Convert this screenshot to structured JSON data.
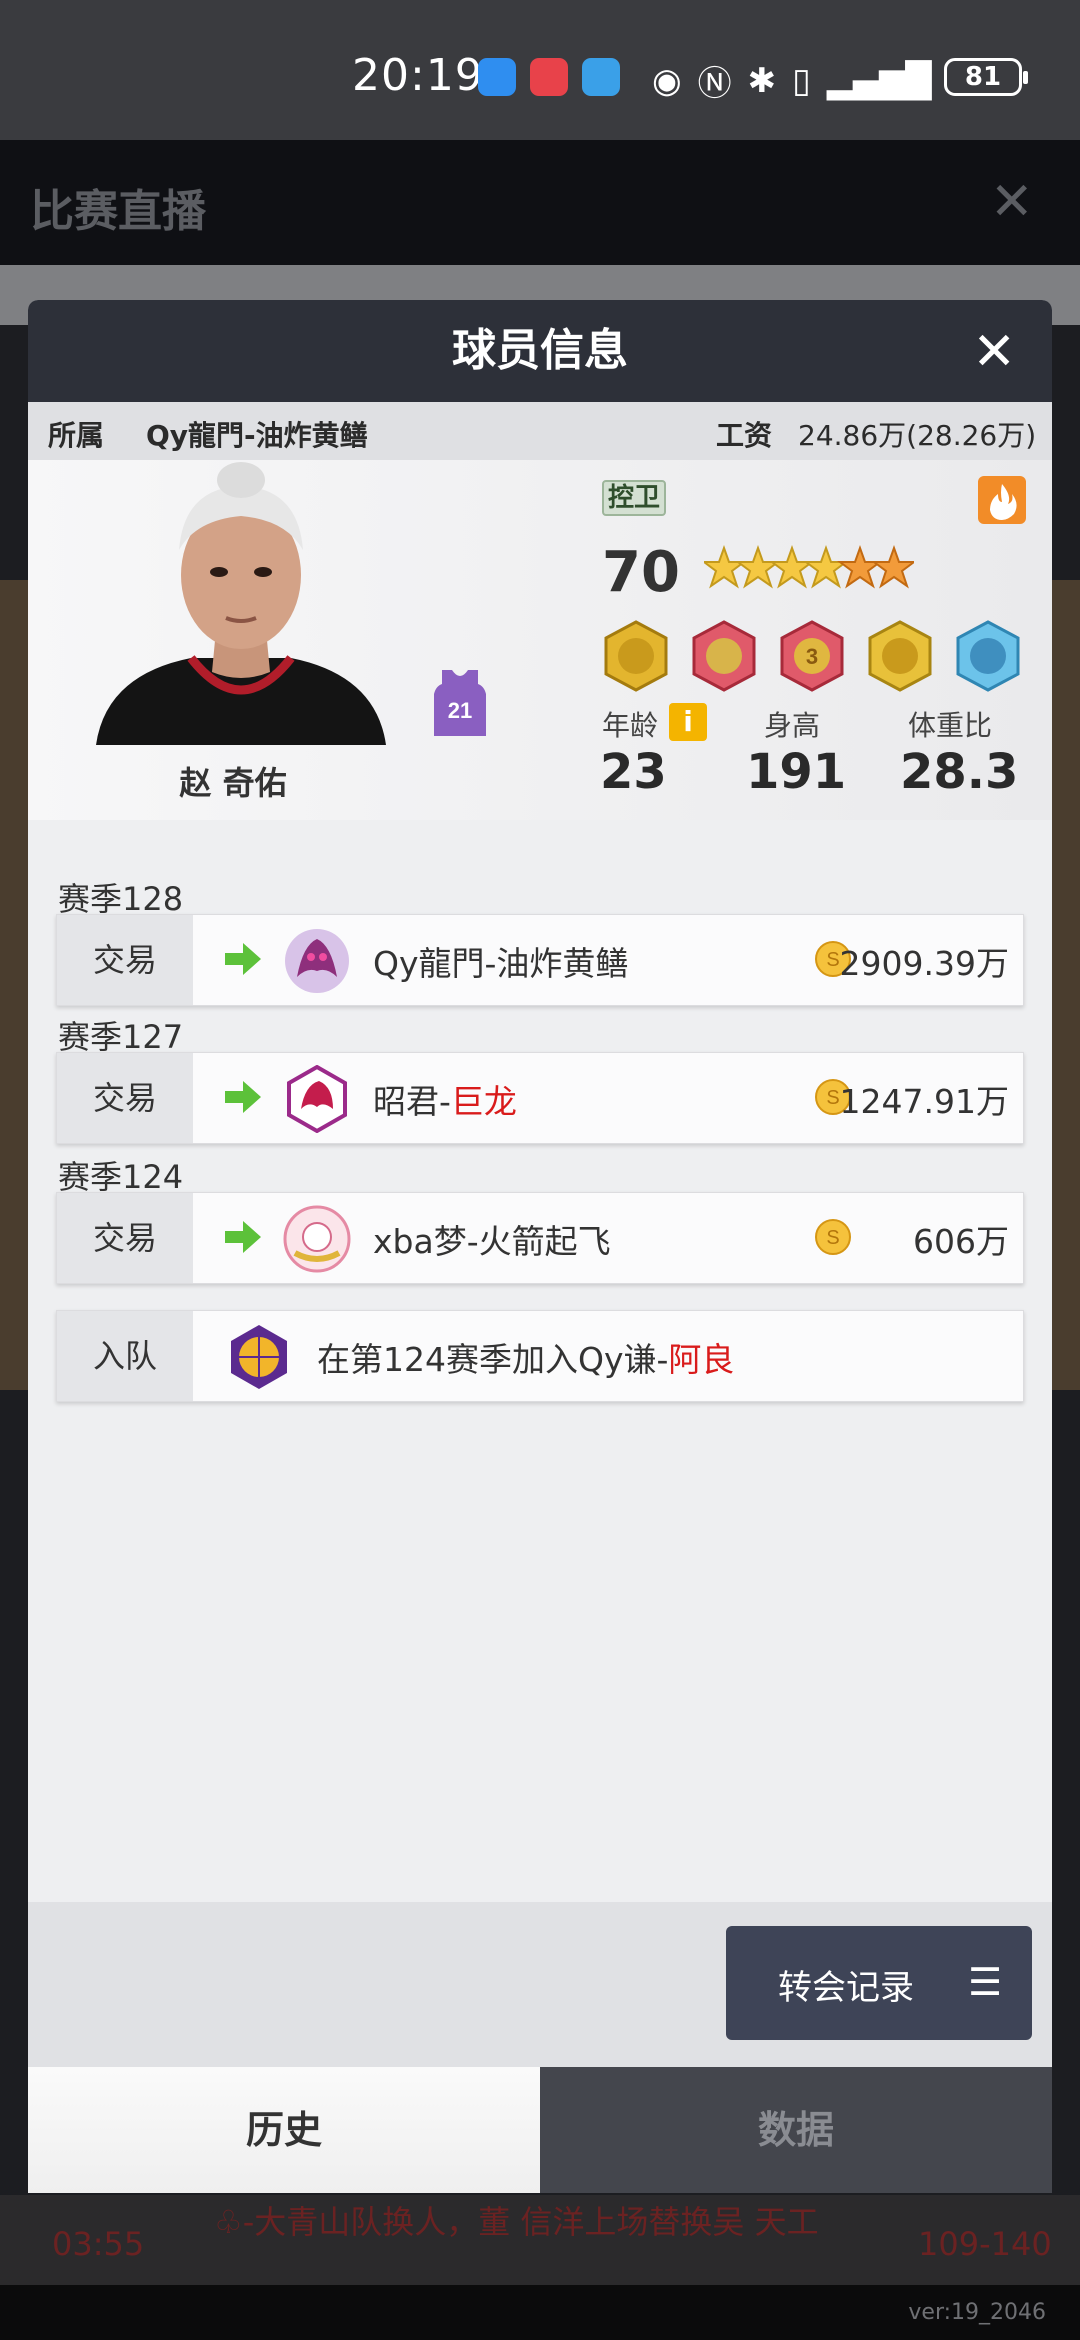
{
  "status_bar": {
    "time": "20:19",
    "battery": "81",
    "icons": [
      "eye-icon",
      "nfc-icon",
      "bluetooth-icon",
      "vibrate-icon",
      "5g-signal-icon"
    ]
  },
  "background": {
    "title": "比赛直播",
    "team_left": "♧-大青山",
    "team_right": "Qy龍門-油炸黄鳝",
    "clock": "03:55",
    "feed_time": "03:55",
    "feed_message": "♧-大青山队换人，董 信洋上场替换吴 天工",
    "feed_score": "109-140",
    "version": "ver:19_2046"
  },
  "modal": {
    "title": "球员信息",
    "affiliation_label": "所属",
    "affiliation_value": "Qy龍門-油炸黄鳝",
    "salary_label": "工资",
    "salary_value": "24.86万(28.26万)"
  },
  "player": {
    "name": "赵 奇佑",
    "jersey_number": "21",
    "position": "控卫",
    "rating": "70",
    "stars": 6,
    "age_label": "年龄",
    "age": "23",
    "height_label": "身高",
    "height": "191",
    "weight_ratio_label": "体重比",
    "weight_ratio": "28.3"
  },
  "history": [
    {
      "season": "赛季128",
      "records": [
        {
          "type": "交易",
          "team_prefix": "Qy龍門-油炸黄鳝",
          "team_suffix": "",
          "price": "2909.39万"
        }
      ]
    },
    {
      "season": "赛季127",
      "records": [
        {
          "type": "交易",
          "team_prefix": "昭君-",
          "team_suffix": "巨龙",
          "price": "1247.91万"
        }
      ]
    },
    {
      "season": "赛季124",
      "records": [
        {
          "type": "交易",
          "team_prefix": "xba梦-火箭起飞",
          "team_suffix": "",
          "price": "606万"
        },
        {
          "type": "入队",
          "team_prefix": "在第124赛季加入Qy谦-",
          "team_suffix": "阿良",
          "price": ""
        }
      ]
    }
  ],
  "buttons": {
    "transfer_record": "转会记录",
    "menu_glyph": "☰"
  },
  "tabs": {
    "history": "历史",
    "stats": "数据"
  },
  "colors": {
    "accent_red": "#d91b1b",
    "header_dark": "#2d3039",
    "tab_inactive": "#44464d"
  }
}
